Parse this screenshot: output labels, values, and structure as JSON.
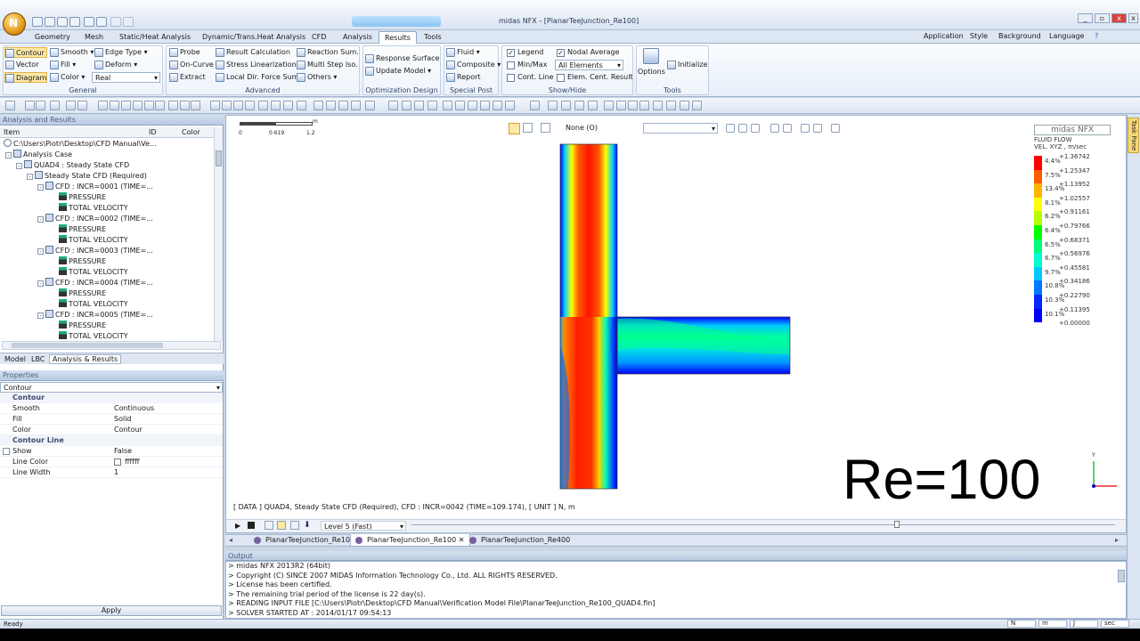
{
  "app": {
    "title": "midas NFX - [PlanarTeeJunction_Re100]",
    "logo_letter": "N"
  },
  "menu_tabs": [
    "Geometry",
    "Mesh",
    "Static/Heat Analysis",
    "Dynamic/Trans.Heat Analysis",
    "CFD",
    "Analysis",
    "Results",
    "Tools"
  ],
  "menu_active": "Results",
  "menu_right": [
    "Application",
    "Style",
    "Background",
    "Language"
  ],
  "ribbon": {
    "general": {
      "label": "General",
      "contour": "Contour",
      "vector": "Vector",
      "diagram": "Diagram",
      "smooth": "Smooth",
      "fill": "Fill",
      "color": "Color",
      "edge_type": "Edge Type",
      "deform": "Deform",
      "deform_value": "Real"
    },
    "advanced": {
      "label": "Advanced",
      "probe": "Probe",
      "on_curve": "On-Curve",
      "extract": "Extract",
      "result_calc": "Result Calculation",
      "stress_lin": "Stress Linearization",
      "local_dir": "Local Dir. Force Sum",
      "reaction": "Reaction Sum.",
      "multistep": "Multi Step Iso.",
      "others": "Others"
    },
    "optimization": {
      "label": "Optimization Design",
      "response_surface": "Response Surface",
      "update_model": "Update Model"
    },
    "special": {
      "label": "Special Post",
      "fluid": "Fluid",
      "composite": "Composite",
      "report": "Report"
    },
    "showhide": {
      "label": "Show/Hide",
      "legend": "Legend",
      "minmax": "Min/Max",
      "cont_line": "Cont. Line",
      "nodal_avg": "Nodal Average",
      "elements": "All Elements",
      "elem_cent": "Elem. Cent. Result"
    },
    "tools": {
      "label": "Tools",
      "options": "Options",
      "initialize": "Initialize"
    }
  },
  "tree": {
    "header": "Analysis and Results",
    "columns": [
      "Item",
      "ID",
      "Color"
    ],
    "root": "C:\\Users\\Piotr\\Desktop\\CFD Manual\\Ve...",
    "analysis_case": "Analysis Case",
    "case": "QUAD4 : Steady State CFD",
    "subcase": "Steady State CFD (Required)",
    "steps": [
      {
        "label": "CFD : INCR=0001 (TIME=...",
        "items": [
          "PRESSURE",
          "TOTAL VELOCITY"
        ]
      },
      {
        "label": "CFD : INCR=0002 (TIME=...",
        "items": [
          "PRESSURE",
          "TOTAL VELOCITY"
        ]
      },
      {
        "label": "CFD : INCR=0003 (TIME=...",
        "items": [
          "PRESSURE",
          "TOTAL VELOCITY"
        ]
      },
      {
        "label": "CFD : INCR=0004 (TIME=...",
        "items": [
          "PRESSURE",
          "TOTAL VELOCITY"
        ]
      },
      {
        "label": "CFD : INCR=0005 (TIME=...",
        "items": [
          "PRESSURE",
          "TOTAL VELOCITY"
        ]
      }
    ],
    "bottom_tabs": [
      "Model",
      "LBC",
      "Analysis & Results"
    ]
  },
  "properties": {
    "header": "Properties",
    "selector": "Contour",
    "section1": "Contour",
    "rows1": [
      {
        "k": "Smooth",
        "v": "Continuous"
      },
      {
        "k": "Fill",
        "v": "Solid"
      },
      {
        "k": "Color",
        "v": "Contour"
      }
    ],
    "section2": "Contour Line",
    "show": {
      "k": "Show",
      "v": "False"
    },
    "line_color": {
      "k": "Line Color",
      "v": "ffffff"
    },
    "line_width": {
      "k": "Line Width",
      "v": "1"
    },
    "apply": "Apply"
  },
  "viewport": {
    "scale_labels": [
      "0",
      "0.619",
      "1.2"
    ],
    "scale_unit": "m",
    "view_dropdown": "None (O)",
    "info_line": "[ DATA ] QUAD4,  Steady State CFD (Required),  CFD : INCR=0042 (TIME=109.174),  [ UNIT ]  N, m",
    "big_label": "Re=100",
    "brand": "midas NFX",
    "legend_title": [
      "FLUID FLOW",
      "VEL. XYZ , m/sec"
    ],
    "legend_values": [
      "+1.36742",
      "+1.25347",
      "+1.13952",
      "+1.02557",
      "+0.91161",
      "+0.79766",
      "+0.68371",
      "+0.56976",
      "+0.45581",
      "+0.34186",
      "+0.22790",
      "+0.11395",
      "+0.00000"
    ],
    "legend_pcts": [
      "4.4%",
      "7.5%",
      "13.4%",
      "8.1%",
      "6.2%",
      "6.4%",
      "6.5%",
      "6.7%",
      "9.7%",
      "10.8%",
      "10.3%",
      "10.1%"
    ],
    "legend_colors": [
      "#ff0000",
      "#ff5a00",
      "#ffb400",
      "#ffff00",
      "#b4ff00",
      "#00ff00",
      "#00ff78",
      "#00ffd2",
      "#00c8ff",
      "#0078ff",
      "#0028ff",
      "#0000ff"
    ],
    "axis_y": "Y"
  },
  "anim": {
    "level": "Level 5 (Fast)"
  },
  "doc_tabs": [
    "PlanarTeeJunction_Re10",
    "PlanarTeeJunction_Re100",
    "PlanarTeeJunction_Re400"
  ],
  "doc_active": "PlanarTeeJunction_Re100",
  "output": {
    "header": "Output",
    "lines": [
      "> midas NFX 2013R2 (64bit)",
      "> Copyright (C) SINCE 2007 MIDAS Information Technology Co., Ltd. ALL RIGHTS RESERVED.",
      "> License has been certified.",
      "> The remaining trial period of the license is 22 day(s).",
      "> READING INPUT FILE [C:\\Users\\Piotr\\Desktop\\CFD Manual\\Verification Model File\\PlanarTeeJunction_Re100_QUAD4.fin]",
      "> SOLVER STARTED AT : 2014/01/17 09:54:13"
    ]
  },
  "status": {
    "left": "Ready",
    "units": [
      "N",
      "m",
      "J",
      "sec"
    ]
  }
}
